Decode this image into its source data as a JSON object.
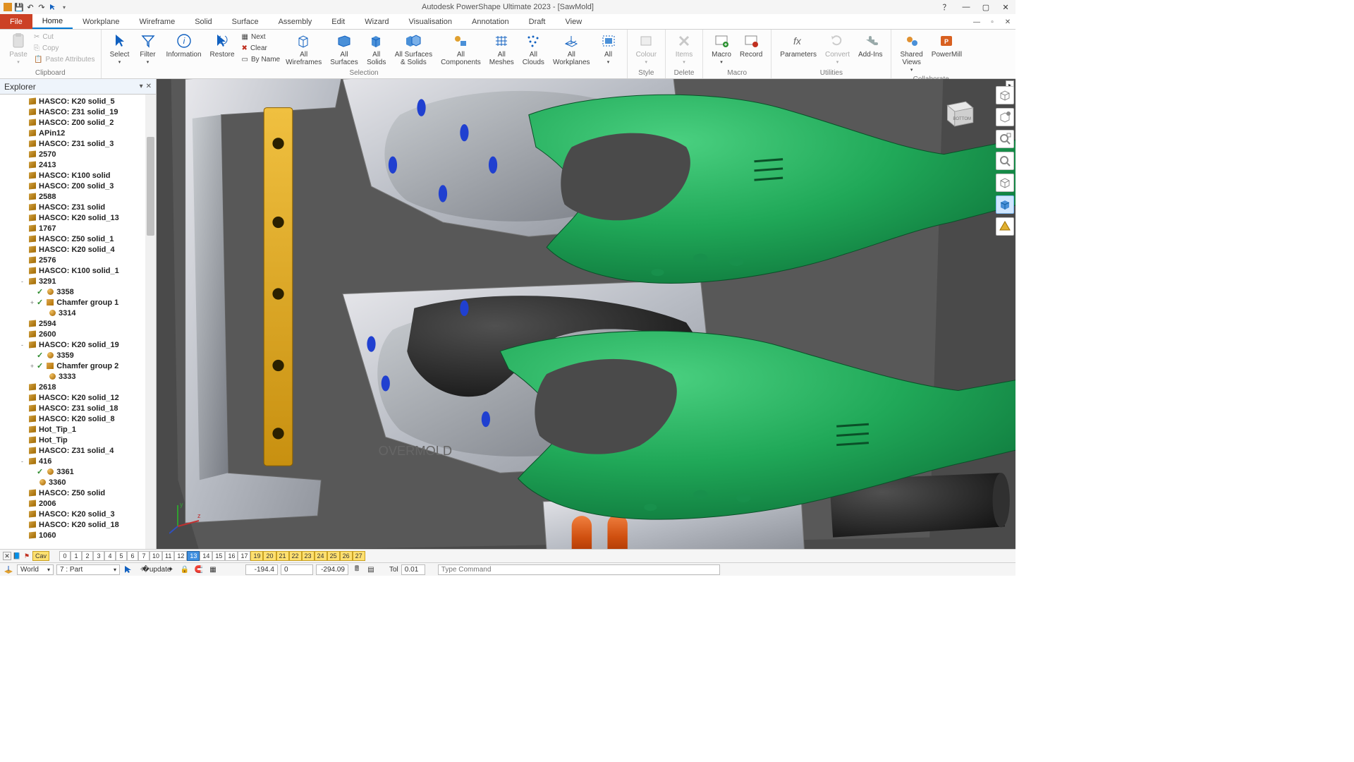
{
  "app": {
    "title": "Autodesk PowerShape Ultimate 2023 - [SawMold]"
  },
  "menu": {
    "file": "File",
    "tabs": [
      "Home",
      "Workplane",
      "Wireframe",
      "Solid",
      "Surface",
      "Assembly",
      "Edit",
      "Wizard",
      "Visualisation",
      "Annotation",
      "Draft",
      "View"
    ],
    "active": "Home"
  },
  "ribbon": {
    "clipboard": {
      "label": "Clipboard",
      "paste": "Paste",
      "cut": "Cut",
      "copy": "Copy",
      "pasteattr": "Paste Attributes"
    },
    "selection": {
      "label": "Selection",
      "select": "Select",
      "filter": "Filter",
      "information": "Information",
      "restore": "Restore",
      "next": "Next",
      "clear": "Clear",
      "byname": "By Name",
      "allwf": "All\nWireframes",
      "allsurf": "All\nSurfaces",
      "allsolid": "All\nSolids",
      "allss": "All Surfaces\n& Solids",
      "allcomp": "All\nComponents",
      "allmesh": "All\nMeshes",
      "allcloud": "All\nClouds",
      "allwp": "All\nWorkplanes",
      "all": "All"
    },
    "style": {
      "label": "Style",
      "colour": "Colour"
    },
    "delete": {
      "label": "Delete",
      "items": "Items"
    },
    "macro": {
      "label": "Macro",
      "macro": "Macro",
      "record": "Record"
    },
    "utilities": {
      "label": "Utilities",
      "params": "Parameters",
      "convert": "Convert",
      "addins": "Add-Ins"
    },
    "collab": {
      "label": "Collaborate",
      "shared": "Shared\nViews",
      "powermill": "PowerMill"
    }
  },
  "explorer": {
    "title": "Explorer",
    "items": [
      {
        "ind": 1,
        "lbl": "HASCO: K20 solid_5",
        "ic": "cube"
      },
      {
        "ind": 1,
        "lbl": "HASCO: Z31 solid_19",
        "ic": "cube"
      },
      {
        "ind": 1,
        "lbl": "HASCO: Z00 solid_2",
        "ic": "cube"
      },
      {
        "ind": 1,
        "lbl": "APin12",
        "ic": "cube"
      },
      {
        "ind": 1,
        "lbl": "HASCO: Z31 solid_3",
        "ic": "cube"
      },
      {
        "ind": 1,
        "lbl": "2570",
        "ic": "cube"
      },
      {
        "ind": 1,
        "lbl": "2413",
        "ic": "cube"
      },
      {
        "ind": 1,
        "lbl": "HASCO: K100 solid",
        "ic": "cube"
      },
      {
        "ind": 1,
        "lbl": "HASCO: Z00 solid_3",
        "ic": "cube"
      },
      {
        "ind": 1,
        "lbl": "2588",
        "ic": "cube"
      },
      {
        "ind": 1,
        "lbl": "HASCO: Z31 solid",
        "ic": "cube"
      },
      {
        "ind": 1,
        "lbl": "HASCO: K20 solid_13",
        "ic": "cube"
      },
      {
        "ind": 1,
        "lbl": "1767",
        "ic": "cube"
      },
      {
        "ind": 1,
        "lbl": "HASCO: Z50 solid_1",
        "ic": "cube"
      },
      {
        "ind": 1,
        "lbl": "HASCO: K20 solid_4",
        "ic": "cube"
      },
      {
        "ind": 1,
        "lbl": "2576",
        "ic": "cube"
      },
      {
        "ind": 1,
        "lbl": "HASCO: K100 solid_1",
        "ic": "cube"
      },
      {
        "ind": 1,
        "tw": "-",
        "lbl": "3291",
        "ic": "cube"
      },
      {
        "ind": 2,
        "chk": true,
        "lbl": "3358",
        "ic": "sph"
      },
      {
        "ind": 2,
        "tw": "+",
        "chk": true,
        "lbl": "Chamfer group 1",
        "ic": "grp"
      },
      {
        "ind": 3,
        "lbl": "3314",
        "ic": "sph"
      },
      {
        "ind": 1,
        "lbl": "2594",
        "ic": "cube"
      },
      {
        "ind": 1,
        "lbl": "2600",
        "ic": "cube"
      },
      {
        "ind": 1,
        "tw": "-",
        "lbl": "HASCO: K20 solid_19",
        "ic": "cube"
      },
      {
        "ind": 2,
        "chk": true,
        "lbl": "3359",
        "ic": "sph"
      },
      {
        "ind": 2,
        "tw": "+",
        "chk": true,
        "lbl": "Chamfer group 2",
        "ic": "grp"
      },
      {
        "ind": 3,
        "lbl": "3333",
        "ic": "sph"
      },
      {
        "ind": 1,
        "lbl": "2618",
        "ic": "cube"
      },
      {
        "ind": 1,
        "lbl": "HASCO: K20 solid_12",
        "ic": "cube"
      },
      {
        "ind": 1,
        "lbl": "HASCO: Z31 solid_18",
        "ic": "cube"
      },
      {
        "ind": 1,
        "lbl": "HASCO: K20 solid_8",
        "ic": "cube"
      },
      {
        "ind": 1,
        "lbl": "Hot_Tip_1",
        "ic": "cube"
      },
      {
        "ind": 1,
        "lbl": "Hot_Tip",
        "ic": "cube"
      },
      {
        "ind": 1,
        "lbl": "HASCO: Z31 solid_4",
        "ic": "cube"
      },
      {
        "ind": 1,
        "tw": "-",
        "lbl": "416",
        "ic": "cube"
      },
      {
        "ind": 2,
        "chk": true,
        "lbl": "3361",
        "ic": "sph"
      },
      {
        "ind": 2,
        "lbl": "3360",
        "ic": "sph"
      },
      {
        "ind": 1,
        "lbl": "HASCO: Z50 solid",
        "ic": "cube"
      },
      {
        "ind": 1,
        "lbl": "2006",
        "ic": "cube"
      },
      {
        "ind": 1,
        "lbl": "HASCO: K20 solid_3",
        "ic": "cube"
      },
      {
        "ind": 1,
        "lbl": "HASCO: K20 solid_18",
        "ic": "cube"
      },
      {
        "ind": 1,
        "lbl": "1060",
        "ic": "cube"
      }
    ]
  },
  "viewcube": {
    "face": "BOTTOM"
  },
  "scene_labels": {
    "overmold": "OVERMOLD"
  },
  "levels": {
    "cav": "Cav",
    "items": [
      {
        "n": "0"
      },
      {
        "n": "1"
      },
      {
        "n": "2"
      },
      {
        "n": "3"
      },
      {
        "n": "4"
      },
      {
        "n": "5"
      },
      {
        "n": "6"
      },
      {
        "n": "7"
      },
      {
        "n": "10"
      },
      {
        "n": "11"
      },
      {
        "n": "12"
      },
      {
        "n": "13",
        "sel": true
      },
      {
        "n": "14"
      },
      {
        "n": "15"
      },
      {
        "n": "16"
      },
      {
        "n": "17"
      },
      {
        "n": "19",
        "hl": true
      },
      {
        "n": "20",
        "hl": true
      },
      {
        "n": "21",
        "hl": true
      },
      {
        "n": "22",
        "hl": true
      },
      {
        "n": "23",
        "hl": true
      },
      {
        "n": "24",
        "hl": true
      },
      {
        "n": "25",
        "hl": true
      },
      {
        "n": "26",
        "hl": true
      },
      {
        "n": "27",
        "hl": true
      }
    ]
  },
  "status": {
    "world": "World",
    "partsel": "7  : Part",
    "x": "-194.4",
    "y": "0",
    "z": "-294.09",
    "tol_label": "Tol",
    "tol": "0.01",
    "cmd_placeholder": "Type Command"
  }
}
